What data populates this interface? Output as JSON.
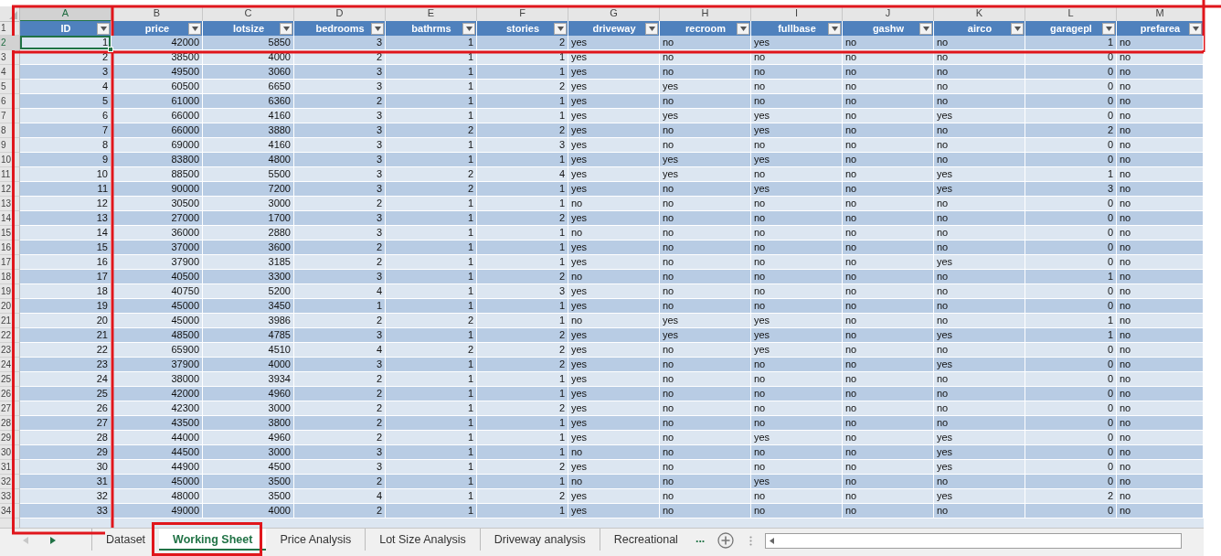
{
  "columns": [
    {
      "letter": "A",
      "title": "ID",
      "kind": "number",
      "selected": true
    },
    {
      "letter": "B",
      "title": "price",
      "kind": "number",
      "selected": false
    },
    {
      "letter": "C",
      "title": "lotsize",
      "kind": "number",
      "selected": false
    },
    {
      "letter": "D",
      "title": "bedrooms",
      "kind": "number",
      "selected": false
    },
    {
      "letter": "E",
      "title": "bathrms",
      "kind": "number",
      "selected": false
    },
    {
      "letter": "F",
      "title": "stories",
      "kind": "number",
      "selected": false
    },
    {
      "letter": "G",
      "title": "driveway",
      "kind": "text",
      "selected": false
    },
    {
      "letter": "H",
      "title": "recroom",
      "kind": "text",
      "selected": false
    },
    {
      "letter": "I",
      "title": "fullbase",
      "kind": "text",
      "selected": false
    },
    {
      "letter": "J",
      "title": "gashw",
      "kind": "text",
      "selected": false
    },
    {
      "letter": "K",
      "title": "airco",
      "kind": "text",
      "selected": false
    },
    {
      "letter": "L",
      "title": "garagepl",
      "kind": "number",
      "selected": false
    },
    {
      "letter": "M",
      "title": "prefarea",
      "kind": "text",
      "selected": false
    }
  ],
  "header_row": {
    "number": "1"
  },
  "rows": [
    {
      "number": "2",
      "selected": true,
      "cells": [
        "1",
        "42000",
        "5850",
        "3",
        "1",
        "2",
        "yes",
        "no",
        "yes",
        "no",
        "no",
        "1",
        "no"
      ]
    },
    {
      "number": "3",
      "selected": false,
      "cells": [
        "2",
        "38500",
        "4000",
        "2",
        "1",
        "1",
        "yes",
        "no",
        "no",
        "no",
        "no",
        "0",
        "no"
      ]
    },
    {
      "number": "4",
      "selected": false,
      "cells": [
        "3",
        "49500",
        "3060",
        "3",
        "1",
        "1",
        "yes",
        "no",
        "no",
        "no",
        "no",
        "0",
        "no"
      ]
    },
    {
      "number": "5",
      "selected": false,
      "cells": [
        "4",
        "60500",
        "6650",
        "3",
        "1",
        "2",
        "yes",
        "yes",
        "no",
        "no",
        "no",
        "0",
        "no"
      ]
    },
    {
      "number": "6",
      "selected": false,
      "cells": [
        "5",
        "61000",
        "6360",
        "2",
        "1",
        "1",
        "yes",
        "no",
        "no",
        "no",
        "no",
        "0",
        "no"
      ]
    },
    {
      "number": "7",
      "selected": false,
      "cells": [
        "6",
        "66000",
        "4160",
        "3",
        "1",
        "1",
        "yes",
        "yes",
        "yes",
        "no",
        "yes",
        "0",
        "no"
      ]
    },
    {
      "number": "8",
      "selected": false,
      "cells": [
        "7",
        "66000",
        "3880",
        "3",
        "2",
        "2",
        "yes",
        "no",
        "yes",
        "no",
        "no",
        "2",
        "no"
      ]
    },
    {
      "number": "9",
      "selected": false,
      "cells": [
        "8",
        "69000",
        "4160",
        "3",
        "1",
        "3",
        "yes",
        "no",
        "no",
        "no",
        "no",
        "0",
        "no"
      ]
    },
    {
      "number": "10",
      "selected": false,
      "cells": [
        "9",
        "83800",
        "4800",
        "3",
        "1",
        "1",
        "yes",
        "yes",
        "yes",
        "no",
        "no",
        "0",
        "no"
      ]
    },
    {
      "number": "11",
      "selected": false,
      "cells": [
        "10",
        "88500",
        "5500",
        "3",
        "2",
        "4",
        "yes",
        "yes",
        "no",
        "no",
        "yes",
        "1",
        "no"
      ]
    },
    {
      "number": "12",
      "selected": false,
      "cells": [
        "11",
        "90000",
        "7200",
        "3",
        "2",
        "1",
        "yes",
        "no",
        "yes",
        "no",
        "yes",
        "3",
        "no"
      ]
    },
    {
      "number": "13",
      "selected": false,
      "cells": [
        "12",
        "30500",
        "3000",
        "2",
        "1",
        "1",
        "no",
        "no",
        "no",
        "no",
        "no",
        "0",
        "no"
      ]
    },
    {
      "number": "14",
      "selected": false,
      "cells": [
        "13",
        "27000",
        "1700",
        "3",
        "1",
        "2",
        "yes",
        "no",
        "no",
        "no",
        "no",
        "0",
        "no"
      ]
    },
    {
      "number": "15",
      "selected": false,
      "cells": [
        "14",
        "36000",
        "2880",
        "3",
        "1",
        "1",
        "no",
        "no",
        "no",
        "no",
        "no",
        "0",
        "no"
      ]
    },
    {
      "number": "16",
      "selected": false,
      "cells": [
        "15",
        "37000",
        "3600",
        "2",
        "1",
        "1",
        "yes",
        "no",
        "no",
        "no",
        "no",
        "0",
        "no"
      ]
    },
    {
      "number": "17",
      "selected": false,
      "cells": [
        "16",
        "37900",
        "3185",
        "2",
        "1",
        "1",
        "yes",
        "no",
        "no",
        "no",
        "yes",
        "0",
        "no"
      ]
    },
    {
      "number": "18",
      "selected": false,
      "cells": [
        "17",
        "40500",
        "3300",
        "3",
        "1",
        "2",
        "no",
        "no",
        "no",
        "no",
        "no",
        "1",
        "no"
      ]
    },
    {
      "number": "19",
      "selected": false,
      "cells": [
        "18",
        "40750",
        "5200",
        "4",
        "1",
        "3",
        "yes",
        "no",
        "no",
        "no",
        "no",
        "0",
        "no"
      ]
    },
    {
      "number": "20",
      "selected": false,
      "cells": [
        "19",
        "45000",
        "3450",
        "1",
        "1",
        "1",
        "yes",
        "no",
        "no",
        "no",
        "no",
        "0",
        "no"
      ]
    },
    {
      "number": "21",
      "selected": false,
      "cells": [
        "20",
        "45000",
        "3986",
        "2",
        "2",
        "1",
        "no",
        "yes",
        "yes",
        "no",
        "no",
        "1",
        "no"
      ]
    },
    {
      "number": "22",
      "selected": false,
      "cells": [
        "21",
        "48500",
        "4785",
        "3",
        "1",
        "2",
        "yes",
        "yes",
        "yes",
        "no",
        "yes",
        "1",
        "no"
      ]
    },
    {
      "number": "23",
      "selected": false,
      "cells": [
        "22",
        "65900",
        "4510",
        "4",
        "2",
        "2",
        "yes",
        "no",
        "yes",
        "no",
        "no",
        "0",
        "no"
      ]
    },
    {
      "number": "24",
      "selected": false,
      "cells": [
        "23",
        "37900",
        "4000",
        "3",
        "1",
        "2",
        "yes",
        "no",
        "no",
        "no",
        "yes",
        "0",
        "no"
      ]
    },
    {
      "number": "25",
      "selected": false,
      "cells": [
        "24",
        "38000",
        "3934",
        "2",
        "1",
        "1",
        "yes",
        "no",
        "no",
        "no",
        "no",
        "0",
        "no"
      ]
    },
    {
      "number": "26",
      "selected": false,
      "cells": [
        "25",
        "42000",
        "4960",
        "2",
        "1",
        "1",
        "yes",
        "no",
        "no",
        "no",
        "no",
        "0",
        "no"
      ]
    },
    {
      "number": "27",
      "selected": false,
      "cells": [
        "26",
        "42300",
        "3000",
        "2",
        "1",
        "2",
        "yes",
        "no",
        "no",
        "no",
        "no",
        "0",
        "no"
      ]
    },
    {
      "number": "28",
      "selected": false,
      "cells": [
        "27",
        "43500",
        "3800",
        "2",
        "1",
        "1",
        "yes",
        "no",
        "no",
        "no",
        "no",
        "0",
        "no"
      ]
    },
    {
      "number": "29",
      "selected": false,
      "cells": [
        "28",
        "44000",
        "4960",
        "2",
        "1",
        "1",
        "yes",
        "no",
        "yes",
        "no",
        "yes",
        "0",
        "no"
      ]
    },
    {
      "number": "30",
      "selected": false,
      "cells": [
        "29",
        "44500",
        "3000",
        "3",
        "1",
        "1",
        "no",
        "no",
        "no",
        "no",
        "yes",
        "0",
        "no"
      ]
    },
    {
      "number": "31",
      "selected": false,
      "cells": [
        "30",
        "44900",
        "4500",
        "3",
        "1",
        "2",
        "yes",
        "no",
        "no",
        "no",
        "yes",
        "0",
        "no"
      ]
    },
    {
      "number": "32",
      "selected": false,
      "cells": [
        "31",
        "45000",
        "3500",
        "2",
        "1",
        "1",
        "no",
        "no",
        "yes",
        "no",
        "no",
        "0",
        "no"
      ]
    },
    {
      "number": "33",
      "selected": false,
      "cells": [
        "32",
        "48000",
        "3500",
        "4",
        "1",
        "2",
        "yes",
        "no",
        "no",
        "no",
        "yes",
        "2",
        "no"
      ]
    },
    {
      "number": "34",
      "selected": false,
      "cells": [
        "33",
        "49000",
        "4000",
        "2",
        "1",
        "1",
        "yes",
        "no",
        "no",
        "no",
        "no",
        "0",
        "no"
      ]
    }
  ],
  "sheet_tabs": {
    "scroll_buttons": [
      {
        "kind": "left",
        "disabled": true
      },
      {
        "kind": "right",
        "disabled": false
      }
    ],
    "tabs": [
      {
        "label": "Dataset",
        "selected": false
      },
      {
        "label": "Working Sheet",
        "selected": true
      },
      {
        "label": "Price Analysis",
        "selected": false
      },
      {
        "label": "Lot Size Analysis",
        "selected": false
      },
      {
        "label": "Driveway analysis",
        "selected": false
      },
      {
        "label": "Recreational",
        "selected": false
      }
    ],
    "more": "..."
  }
}
